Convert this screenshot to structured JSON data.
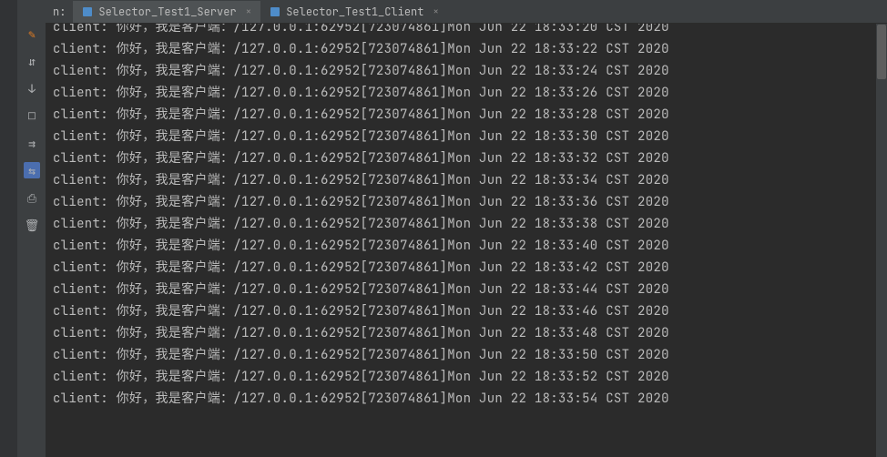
{
  "run_label": "n:",
  "tabs": [
    {
      "label": "Selector_Test1_Server",
      "active": true
    },
    {
      "label": "Selector_Test1_Client",
      "active": false
    }
  ],
  "console_lines": [
    {
      "prefix": "client:",
      "msg": "你好，我是客户端：",
      "addr": "/127.0.0.1:62952[723074861]Mon Jun 22 18:33:22 CST 2020"
    },
    {
      "prefix": "client:",
      "msg": "你好，我是客户端：",
      "addr": "/127.0.0.1:62952[723074861]Mon Jun 22 18:33:24 CST 2020"
    },
    {
      "prefix": "client:",
      "msg": "你好，我是客户端：",
      "addr": "/127.0.0.1:62952[723074861]Mon Jun 22 18:33:26 CST 2020"
    },
    {
      "prefix": "client:",
      "msg": "你好，我是客户端：",
      "addr": "/127.0.0.1:62952[723074861]Mon Jun 22 18:33:28 CST 2020"
    },
    {
      "prefix": "client:",
      "msg": "你好，我是客户端：",
      "addr": "/127.0.0.1:62952[723074861]Mon Jun 22 18:33:30 CST 2020"
    },
    {
      "prefix": "client:",
      "msg": "你好，我是客户端：",
      "addr": "/127.0.0.1:62952[723074861]Mon Jun 22 18:33:32 CST 2020"
    },
    {
      "prefix": "client:",
      "msg": "你好，我是客户端：",
      "addr": "/127.0.0.1:62952[723074861]Mon Jun 22 18:33:34 CST 2020"
    },
    {
      "prefix": "client:",
      "msg": "你好，我是客户端：",
      "addr": "/127.0.0.1:62952[723074861]Mon Jun 22 18:33:36 CST 2020"
    },
    {
      "prefix": "client:",
      "msg": "你好，我是客户端：",
      "addr": "/127.0.0.1:62952[723074861]Mon Jun 22 18:33:38 CST 2020"
    },
    {
      "prefix": "client:",
      "msg": "你好，我是客户端：",
      "addr": "/127.0.0.1:62952[723074861]Mon Jun 22 18:33:40 CST 2020"
    },
    {
      "prefix": "client:",
      "msg": "你好，我是客户端：",
      "addr": "/127.0.0.1:62952[723074861]Mon Jun 22 18:33:42 CST 2020"
    },
    {
      "prefix": "client:",
      "msg": "你好，我是客户端：",
      "addr": "/127.0.0.1:62952[723074861]Mon Jun 22 18:33:44 CST 2020"
    },
    {
      "prefix": "client:",
      "msg": "你好，我是客户端：",
      "addr": "/127.0.0.1:62952[723074861]Mon Jun 22 18:33:46 CST 2020"
    },
    {
      "prefix": "client:",
      "msg": "你好，我是客户端：",
      "addr": "/127.0.0.1:62952[723074861]Mon Jun 22 18:33:48 CST 2020"
    },
    {
      "prefix": "client:",
      "msg": "你好，我是客户端：",
      "addr": "/127.0.0.1:62952[723074861]Mon Jun 22 18:33:50 CST 2020"
    },
    {
      "prefix": "client:",
      "msg": "你好，我是客户端：",
      "addr": "/127.0.0.1:62952[723074861]Mon Jun 22 18:33:52 CST 2020"
    },
    {
      "prefix": "client:",
      "msg": "你好，我是客户端：",
      "addr": "/127.0.0.1:62952[723074861]Mon Jun 22 18:33:54 CST 2020"
    }
  ],
  "partial_top_line": {
    "prefix": "client:",
    "msg": "你好，我是客户端：",
    "addr": "/127.0.0.1:62952[723074861]Mon Jun 22 18:33:20 CST 2020"
  },
  "toolbar_icons": [
    {
      "name": "edit-icon",
      "glyph": "✎"
    },
    {
      "name": "debug-icon",
      "glyph": "⇵"
    },
    {
      "name": "scroll-icon",
      "glyph": "↓"
    },
    {
      "name": "stop-icon",
      "glyph": "□"
    },
    {
      "name": "wrap-icon",
      "glyph": "⇉"
    },
    {
      "name": "soft-wrap-icon",
      "glyph": "⇆"
    },
    {
      "name": "print-icon",
      "glyph": "⎙"
    },
    {
      "name": "delete-icon",
      "glyph": "🗑"
    }
  ]
}
